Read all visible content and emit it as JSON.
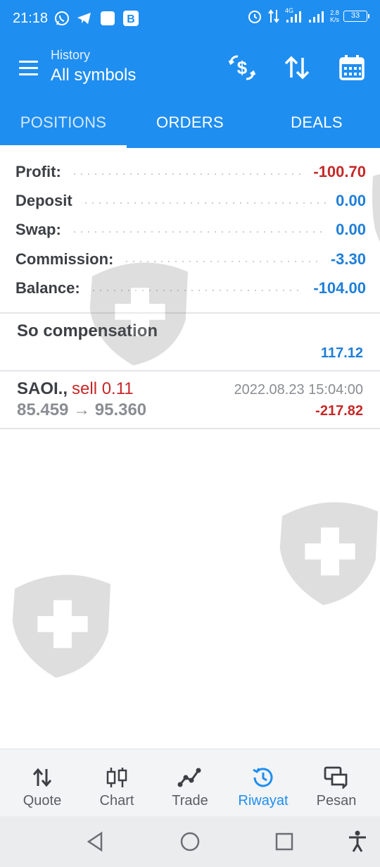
{
  "status_bar": {
    "time": "21:18",
    "network": "4G",
    "speed": "2.8",
    "speed_unit": "K/s",
    "battery": "33"
  },
  "header": {
    "subtitle": "History",
    "title": "All symbols"
  },
  "tabs": [
    {
      "label": "POSITIONS",
      "active": true
    },
    {
      "label": "ORDERS",
      "active": false
    },
    {
      "label": "DEALS",
      "active": false
    }
  ],
  "summary": {
    "profit_label": "Profit:",
    "profit_value": "-100.70",
    "deposit_label": "Deposit",
    "deposit_value": "0.00",
    "swap_label": "Swap:",
    "swap_value": "0.00",
    "commission_label": "Commission:",
    "commission_value": "-3.30",
    "balance_label": "Balance:",
    "balance_value": "-104.00"
  },
  "compensation": {
    "label": "So compensation",
    "value": "117.12"
  },
  "deal": {
    "symbol": "SAOI.,",
    "side": "sell 0.11",
    "prices": "85.459 → 95.360",
    "datetime": "2022.08.23 15:04:00",
    "profit": "-217.82"
  },
  "bottom_nav": [
    {
      "label": "Quote",
      "icon": "quote-arrows-icon"
    },
    {
      "label": "Chart",
      "icon": "candlestick-icon"
    },
    {
      "label": "Trade",
      "icon": "trade-line-icon"
    },
    {
      "label": "Riwayat",
      "icon": "history-clock-icon",
      "active": true
    },
    {
      "label": "Pesan",
      "icon": "messages-icon"
    }
  ],
  "colors": {
    "accent": "#1f8ef1",
    "negative": "#c62828",
    "positive_blue": "#1f7ed8"
  }
}
